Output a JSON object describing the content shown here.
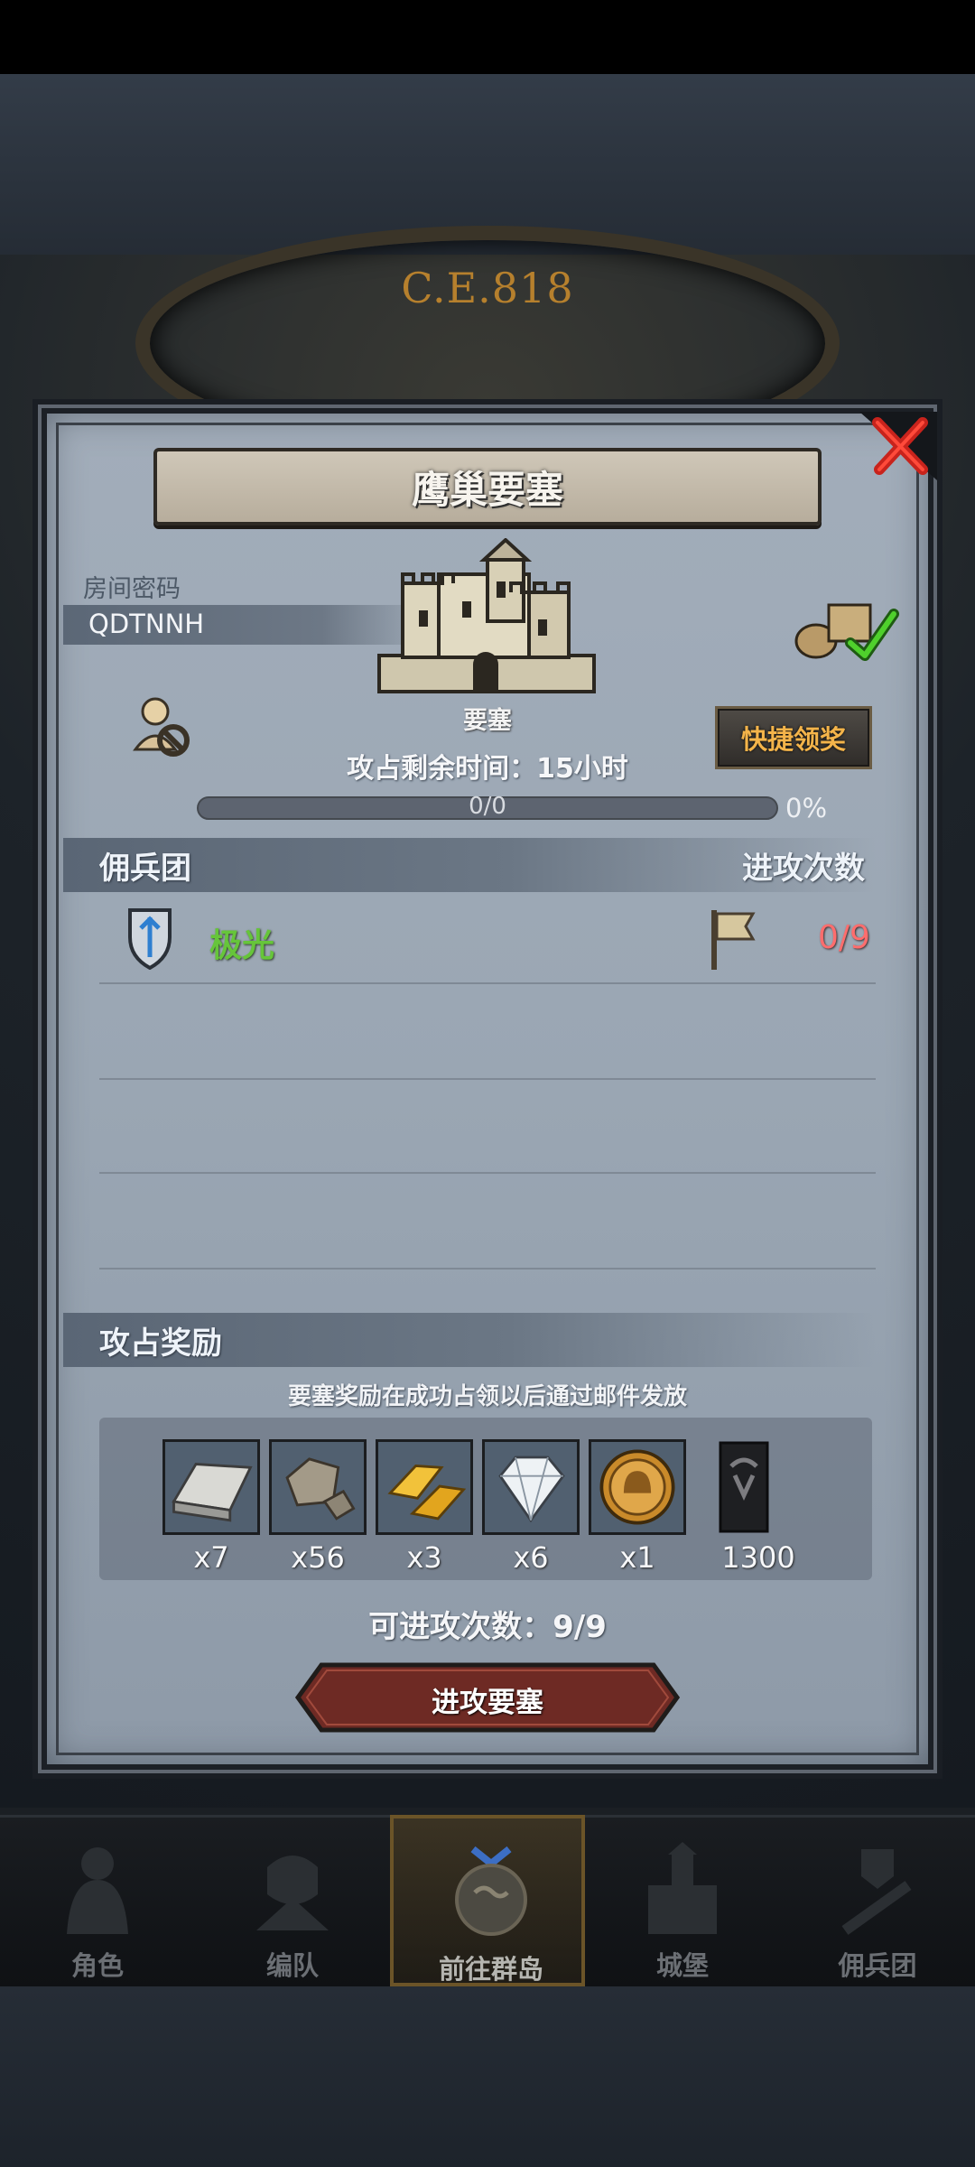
{
  "era_label": "C.E.818",
  "dialog": {
    "title": "鹰巢要塞",
    "room_code_label": "房间密码",
    "room_code": "QDTNNH",
    "building_label": "要塞",
    "quick_claim_label": "快捷领奖",
    "timer_text": "攻占剩余时间：15小时",
    "progress": {
      "text": "0/0",
      "percent_label": "0%",
      "fraction": 0
    },
    "mercenary_header": "佣兵团",
    "attack_count_header": "进攻次数",
    "mercenaries": [
      {
        "name": "极光",
        "attacks": "0/9"
      }
    ],
    "rewards_header": "攻占奖励",
    "rewards_note": "要塞奖励在成功占领以后通过邮件发放",
    "rewards": [
      {
        "icon": "iron-ingot-icon",
        "qty": "x7"
      },
      {
        "icon": "stone-ore-icon",
        "qty": "x56"
      },
      {
        "icon": "gold-bars-icon",
        "qty": "x3"
      },
      {
        "icon": "diamond-icon",
        "qty": "x6"
      },
      {
        "icon": "knight-medal-icon",
        "qty": "x1"
      },
      {
        "icon": "bull-banner-icon",
        "qty": "1300"
      }
    ],
    "remaining_attacks_text": "可进攻次数：9/9",
    "attack_button_label": "进攻要塞"
  },
  "bottom_nav": [
    {
      "label": "角色",
      "icon": "character-icon",
      "active": false
    },
    {
      "label": "编队",
      "icon": "formation-icon",
      "active": false
    },
    {
      "label": "前往群岛",
      "icon": "islands-icon",
      "active": true
    },
    {
      "label": "城堡",
      "icon": "castle-icon",
      "active": false
    },
    {
      "label": "佣兵团",
      "icon": "mercenary-icon",
      "active": false
    }
  ],
  "colors": {
    "merc_name": "#66c53a",
    "attack_count": "#ff6d6d",
    "quick_claim_text": "#f4b44a",
    "panel": "#9aa6b3"
  }
}
